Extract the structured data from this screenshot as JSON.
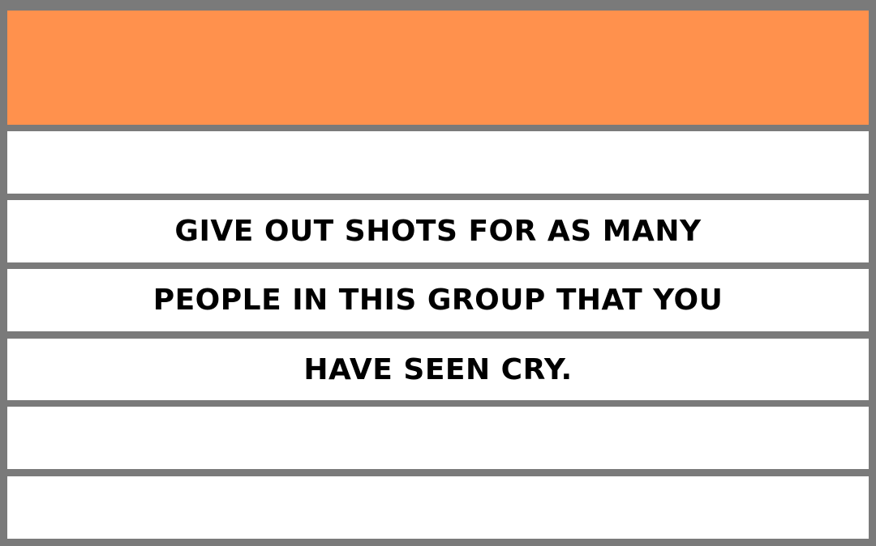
{
  "card": {
    "header_color": "#ff914d",
    "line_color": "#7a7a7a",
    "lines": [
      "",
      "GIVE OUT SHOTS FOR AS MANY",
      "PEOPLE IN THIS GROUP THAT YOU",
      "HAVE SEEN CRY.",
      "",
      ""
    ]
  }
}
